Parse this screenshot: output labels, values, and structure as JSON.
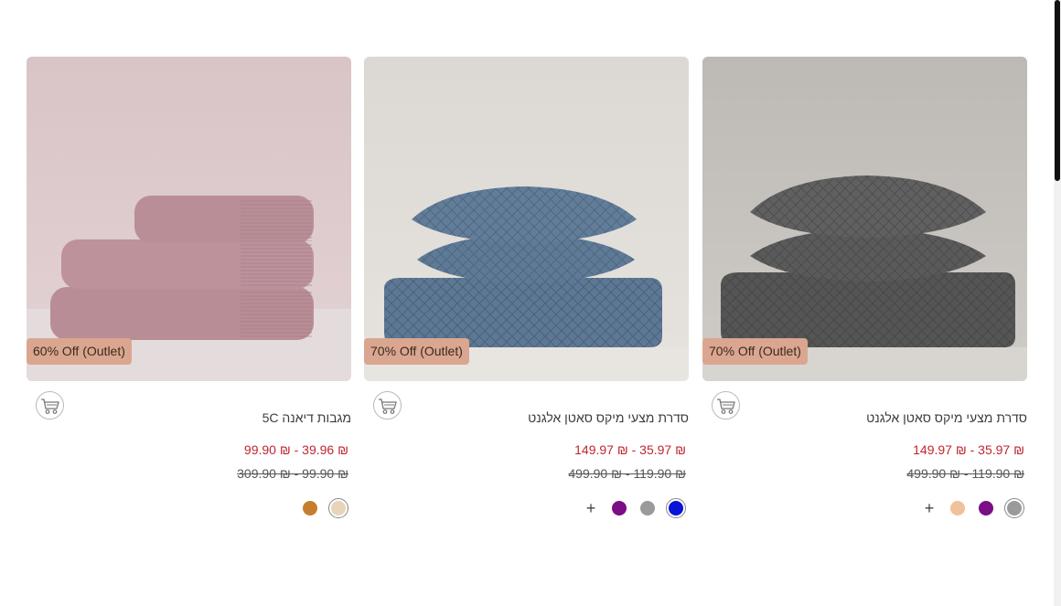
{
  "colors": {
    "badge_bg": "#dba68f",
    "price_sale": "#c0262d"
  },
  "products": [
    {
      "title": "סדרת מצעי מיקס סאטן אלגנט",
      "badge": "70% Off (Outlet)",
      "price_range": "₪ 35.97 - ₪ 149.97",
      "price_old": "₪ 119.90 - ₪ 499.90",
      "cart_icon": "cart-icon",
      "swatches": [
        "#9a9a9a",
        "#7b0d86",
        "#efc29a"
      ],
      "selected_swatch": 0,
      "more_label": "+"
    },
    {
      "title": "סדרת מצעי מיקס סאטן אלגנט",
      "badge": "70% Off (Outlet)",
      "price_range": "₪ 35.97 - ₪ 149.97",
      "price_old": "₪ 119.90 - ₪ 499.90",
      "cart_icon": "cart-icon",
      "swatches": [
        "#0a13d8",
        "#9a9a9a",
        "#7b0d86"
      ],
      "selected_swatch": 0,
      "more_label": "+"
    },
    {
      "title": "מגבות דיאנה 5C",
      "badge": "60% Off (Outlet)",
      "price_range": "₪ 39.96 - ₪ 99.90",
      "price_old": "₪ 99.90 - ₪ 309.90",
      "cart_icon": "cart-icon",
      "swatches": [
        "#e8d4b8",
        "#c77d2e"
      ],
      "selected_swatch": 0,
      "more_label": ""
    }
  ]
}
